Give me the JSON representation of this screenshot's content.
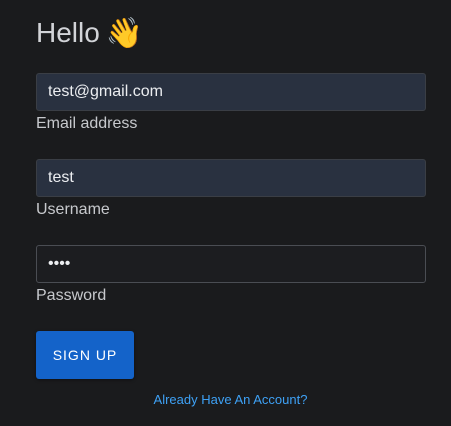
{
  "header": {
    "title": "Hello",
    "wave_emoji": "👋"
  },
  "form": {
    "email": {
      "value": "test@gmail.com",
      "label": "Email address"
    },
    "username": {
      "value": "test",
      "label": "Username"
    },
    "password": {
      "value": "test",
      "label": "Password"
    },
    "submit_label": "SIGN UP",
    "login_link": "Already Have An Account?"
  },
  "colors": {
    "background": "#1a1b1d",
    "input_fill": "#293140",
    "button": "#1463c9",
    "link": "#3ea1f5"
  }
}
